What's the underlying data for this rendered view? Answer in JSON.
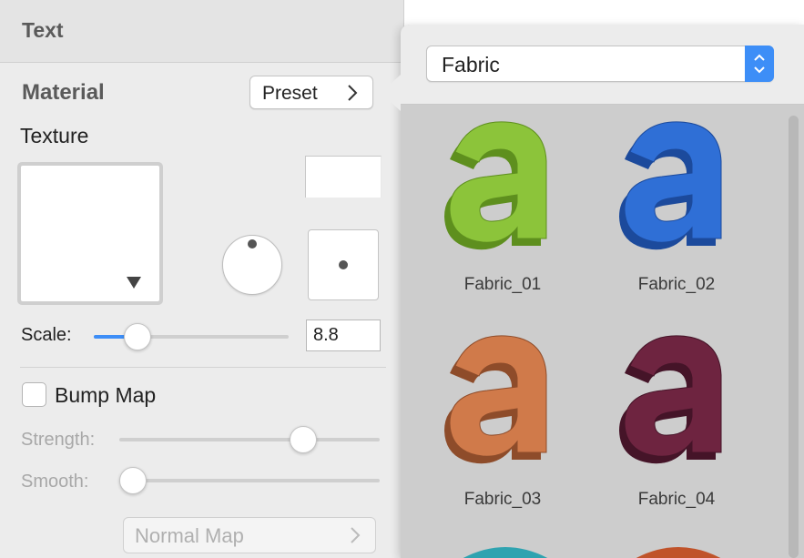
{
  "inspector": {
    "section_title": "Text",
    "material_title": "Material",
    "preset_label": "Preset",
    "texture_label": "Texture",
    "scale_label": "Scale:",
    "scale_value": "8.8",
    "scale_level": 0.18,
    "bump_map_label": "Bump Map",
    "bump_map_checked": false,
    "strength_label": "Strength:",
    "strength_level": 0.73,
    "smooth_label": "Smooth:",
    "smooth_level": 0.0,
    "normal_map_label": "Normal Map"
  },
  "popover": {
    "category": "Fabric",
    "items": [
      {
        "label": "Fabric_01",
        "color": "#8cc43a",
        "dark": "#5e8f1e"
      },
      {
        "label": "Fabric_02",
        "color": "#2f6fd6",
        "dark": "#1c4a9c"
      },
      {
        "label": "Fabric_03",
        "color": "#d07a4a",
        "dark": "#8e4c2a"
      },
      {
        "label": "Fabric_04",
        "color": "#6e2440",
        "dark": "#451428"
      }
    ]
  },
  "colors": {
    "accent": "#3d8ef7"
  }
}
